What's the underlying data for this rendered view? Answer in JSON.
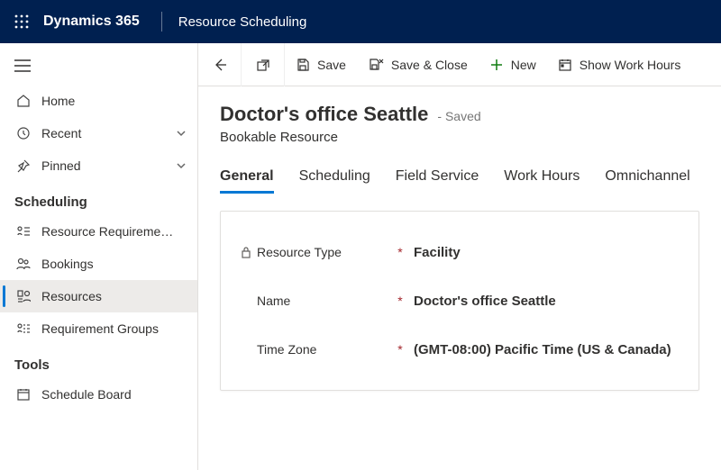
{
  "header": {
    "brand": "Dynamics 365",
    "app": "Resource Scheduling"
  },
  "sidebar": {
    "top": [
      {
        "label": "Home",
        "icon": "home",
        "chevron": false
      },
      {
        "label": "Recent",
        "icon": "recent",
        "chevron": true
      },
      {
        "label": "Pinned",
        "icon": "pin",
        "chevron": true
      }
    ],
    "sections": [
      {
        "title": "Scheduling",
        "items": [
          {
            "label": "Resource Requireme…",
            "icon": "reqlist"
          },
          {
            "label": "Bookings",
            "icon": "bookings"
          },
          {
            "label": "Resources",
            "icon": "resources",
            "active": true
          },
          {
            "label": "Requirement Groups",
            "icon": "reqgroups"
          }
        ]
      },
      {
        "title": "Tools",
        "items": [
          {
            "label": "Schedule Board",
            "icon": "calendar"
          }
        ]
      }
    ]
  },
  "commands": {
    "save": "Save",
    "saveclose": "Save & Close",
    "new": "New",
    "showhours": "Show Work Hours"
  },
  "record": {
    "title": "Doctor's office Seattle",
    "status": "- Saved",
    "entity": "Bookable Resource",
    "tabs": [
      "General",
      "Scheduling",
      "Field Service",
      "Work Hours",
      "Omnichannel"
    ],
    "activeTab": 0,
    "fields": [
      {
        "label": "Resource Type",
        "locked": true,
        "required": true,
        "value": "Facility",
        "bold": true
      },
      {
        "label": "Name",
        "locked": false,
        "required": true,
        "value": "Doctor's office Seattle",
        "bold": true
      },
      {
        "label": "Time Zone",
        "locked": false,
        "required": true,
        "value": "(GMT-08:00) Pacific Time (US & Canada)",
        "bold": true
      }
    ]
  }
}
